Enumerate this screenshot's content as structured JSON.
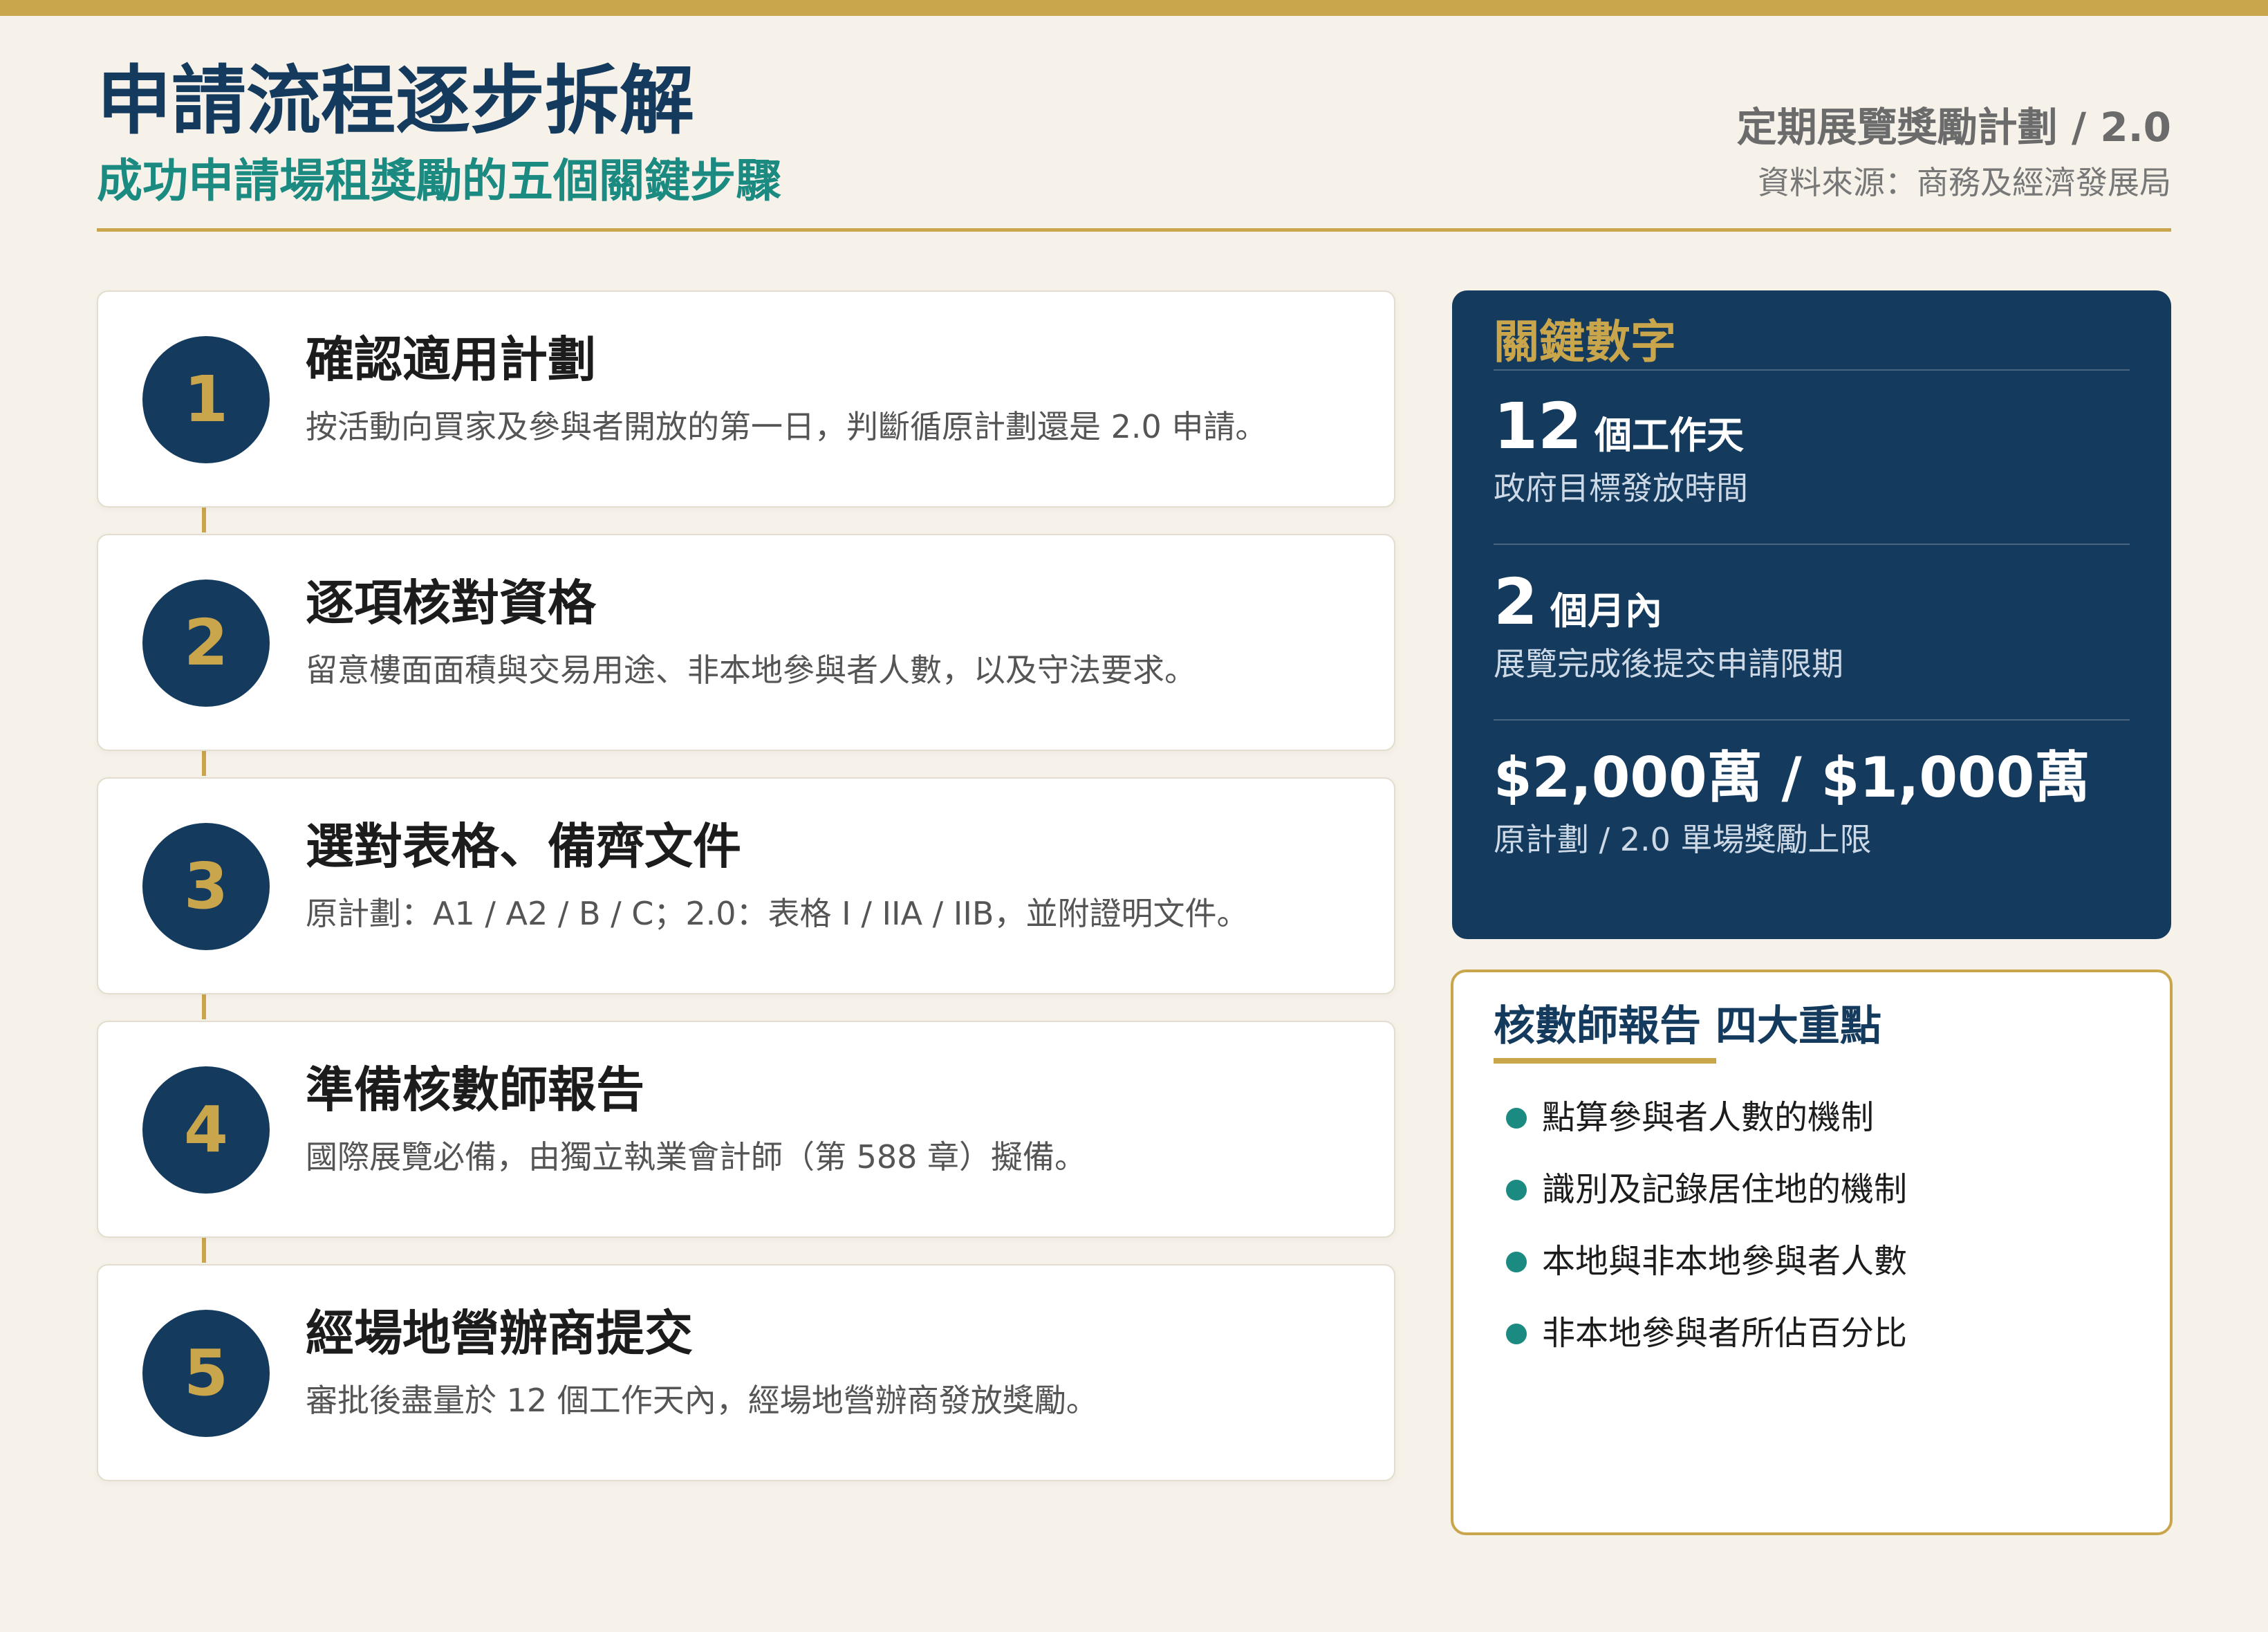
{
  "header": {
    "title": "申請流程逐步拆解",
    "subtitle": "成功申請場租獎勵的五個關鍵步驟",
    "program": "定期展覽獎勵計劃 / 2.0",
    "source": "資料來源：商務及經濟發展局"
  },
  "steps": [
    {
      "number": "1",
      "title": "確認適用計劃",
      "desc": "按活動向買家及參與者開放的第一日，判斷循原計劃還是 2.0 申請。"
    },
    {
      "number": "2",
      "title": "逐項核對資格",
      "desc": "留意樓面面積與交易用途、非本地參與者人數，以及守法要求。"
    },
    {
      "number": "3",
      "title": "選對表格、備齊文件",
      "desc": "原計劃：A1 / A2 / B / C；2.0：表格 I / IIA / IIB，並附證明文件。"
    },
    {
      "number": "4",
      "title": "準備核數師報告",
      "desc": "國際展覽必備，由獨立執業會計師（第 588 章）擬備。"
    },
    {
      "number": "5",
      "title": "經場地營辦商提交",
      "desc": "審批後盡量於 12 個工作天內，經場地營辦商發放獎勵。"
    }
  ],
  "key_numbers": {
    "title": "關鍵數字",
    "items": [
      {
        "value": "12",
        "unit": "個工作天",
        "desc": "政府目標發放時間"
      },
      {
        "value": "2",
        "unit": "個月內",
        "desc": "展覽完成後提交申請限期"
      },
      {
        "value": "$2,000萬 / $1,000萬",
        "unit": "",
        "desc": "原計劃 / 2.0 單場獎勵上限"
      }
    ]
  },
  "audit": {
    "title": "核數師報告 四大重點",
    "items": [
      "點算參與者人數的機制",
      "識別及記錄居住地的機制",
      "本地與非本地參與者人數",
      "非本地參與者所佔百分比"
    ]
  },
  "colors": {
    "navy": "#143a5d",
    "gold": "#c9a54c",
    "teal": "#1b8a80",
    "background": "#f6f2ea"
  }
}
